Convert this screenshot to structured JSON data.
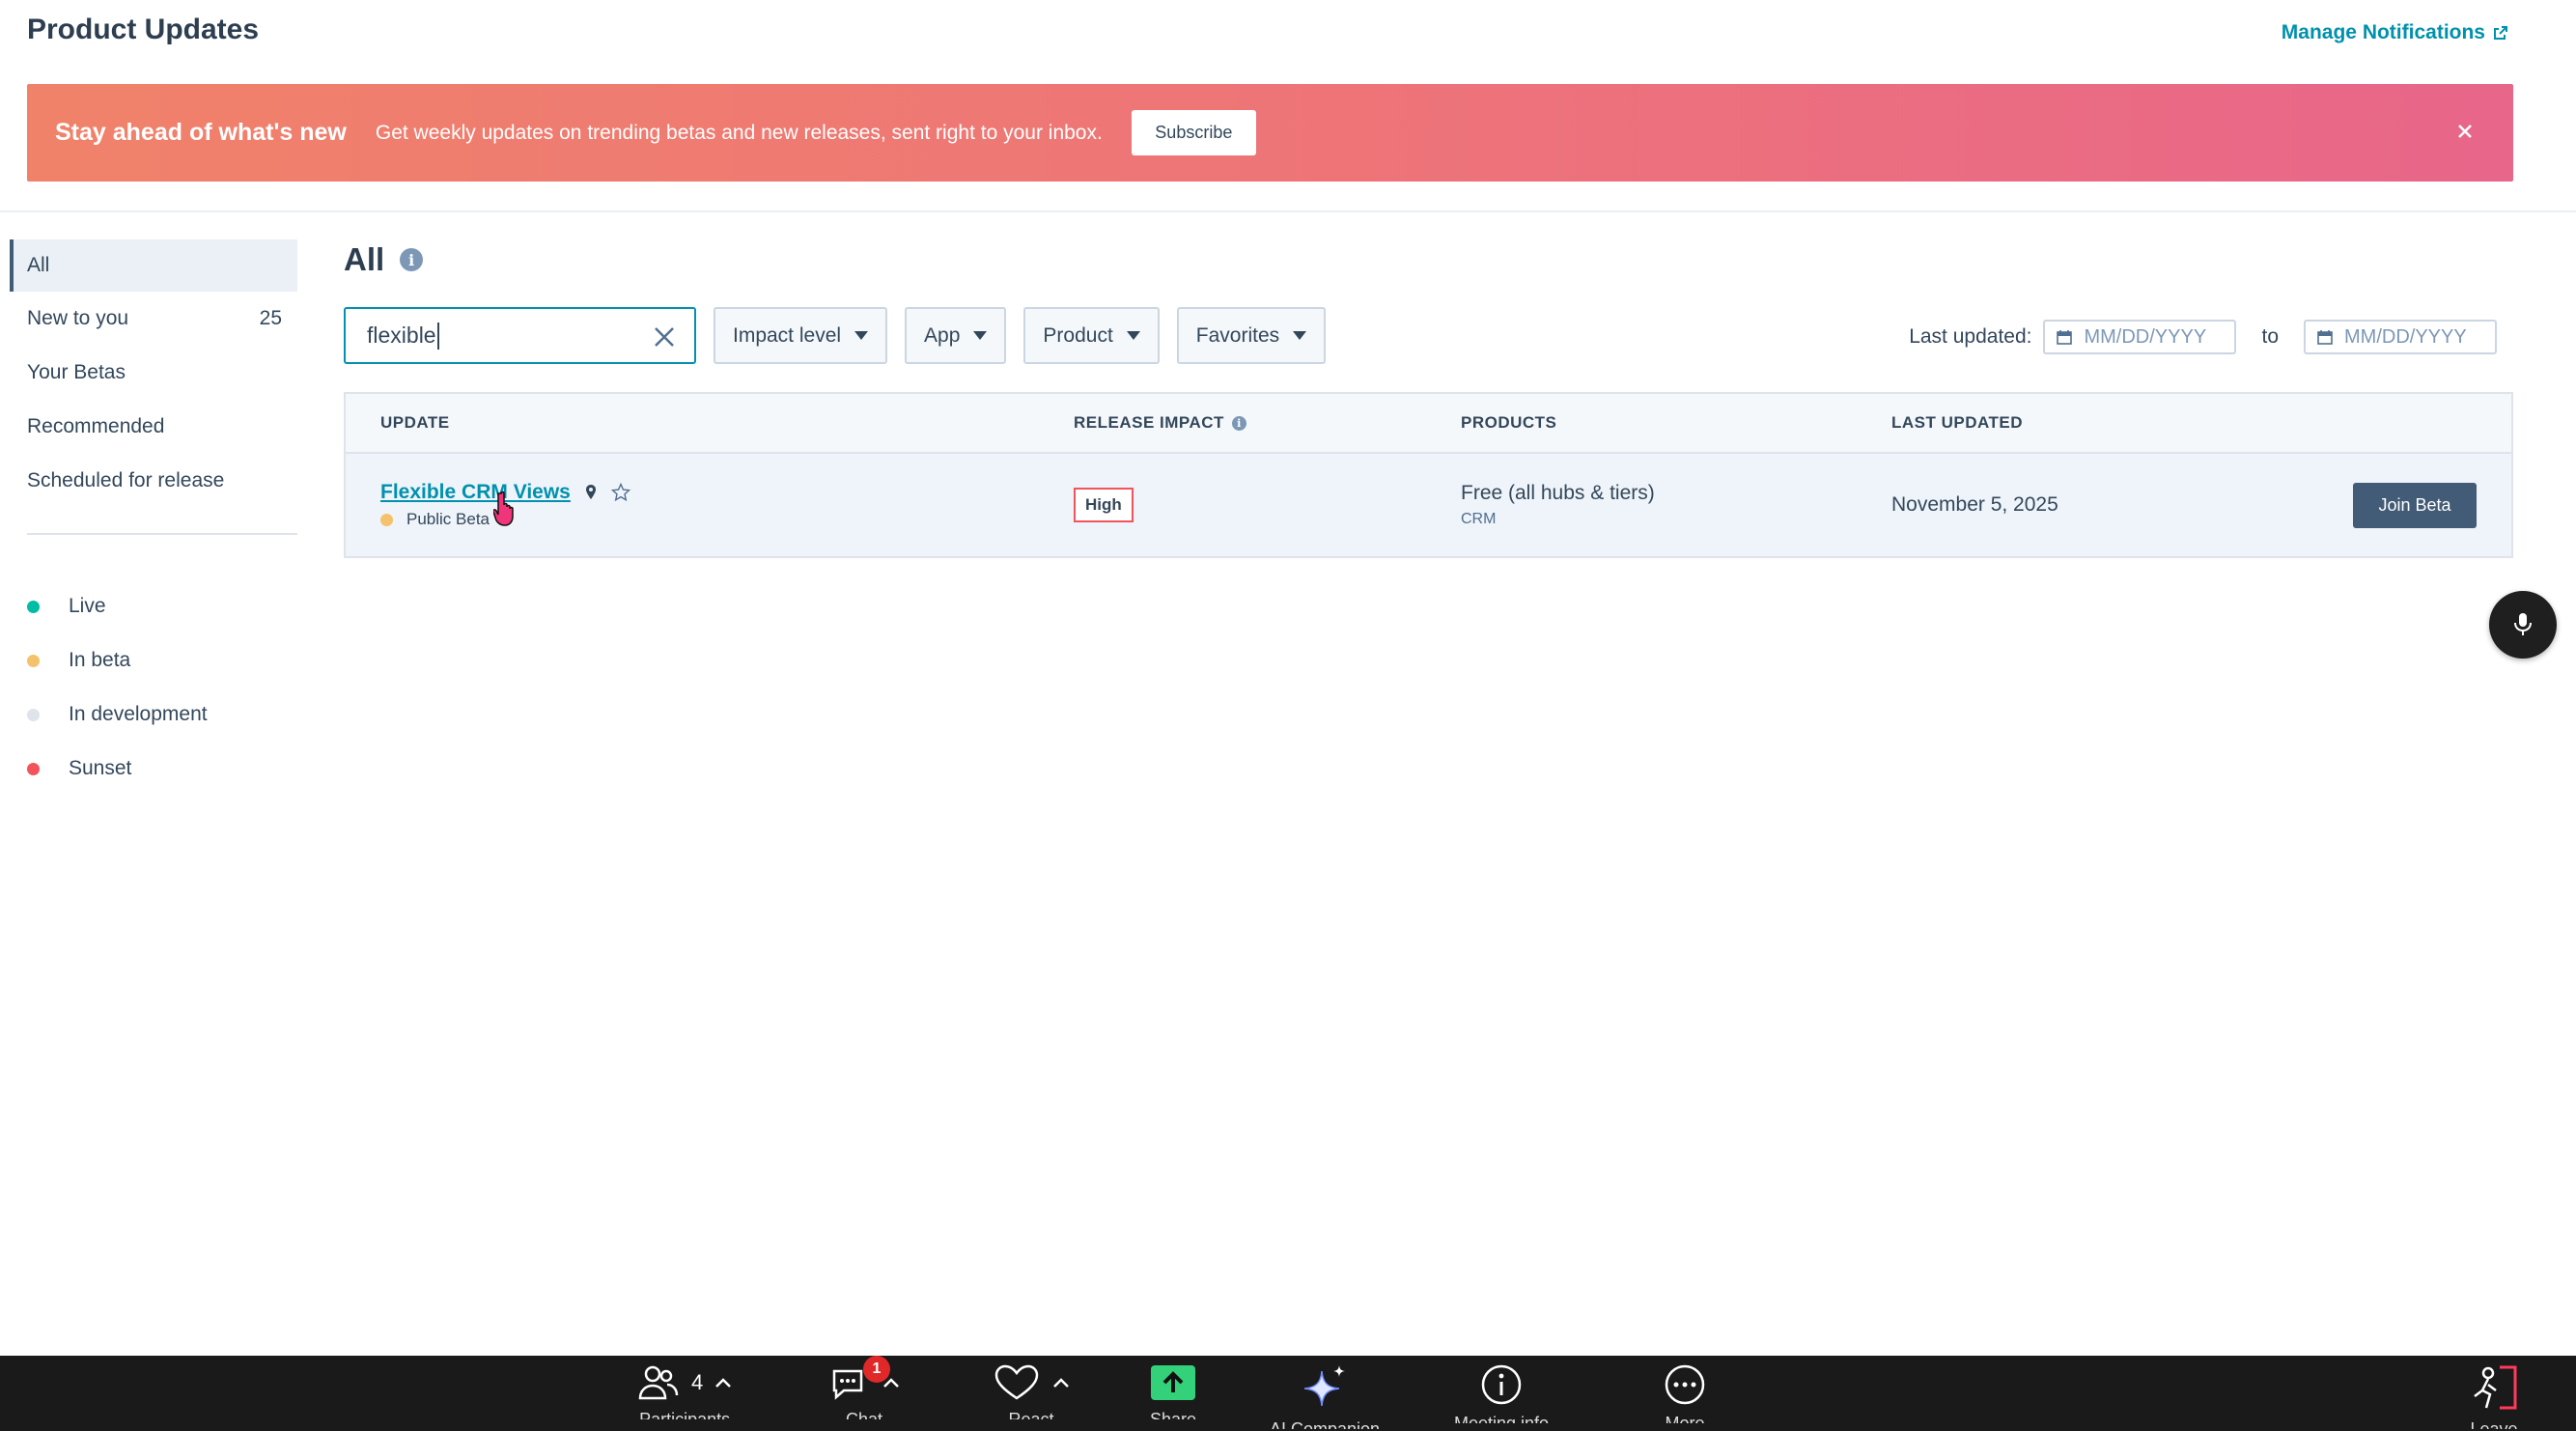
{
  "page": {
    "title": "Product Updates",
    "manage_link": "Manage Notifications"
  },
  "banner": {
    "title": "Stay ahead of what's new",
    "text": "Get weekly updates on trending betas and new releases, sent right to your inbox.",
    "button": "Subscribe",
    "gradient": [
      "#f0826a",
      "#e8668a"
    ]
  },
  "sidebar": {
    "items": [
      {
        "label": "All",
        "count": ""
      },
      {
        "label": "New to you",
        "count": "25"
      },
      {
        "label": "Your Betas",
        "count": ""
      },
      {
        "label": "Recommended",
        "count": ""
      },
      {
        "label": "Scheduled for release",
        "count": ""
      }
    ],
    "legend": [
      {
        "label": "Live",
        "color": "#00bda5"
      },
      {
        "label": "In beta",
        "color": "#f5c26b"
      },
      {
        "label": "In development",
        "color": "#dfe3eb"
      },
      {
        "label": "Sunset",
        "color": "#f2545b"
      }
    ]
  },
  "main": {
    "title": "All",
    "search": {
      "value": "flexible"
    },
    "filters": [
      "Impact level",
      "App",
      "Product",
      "Favorites"
    ],
    "date": {
      "label": "Last updated:",
      "from_placeholder": "MM/DD/YYYY",
      "to_label": "to",
      "to_placeholder": "MM/DD/YYYY"
    }
  },
  "table": {
    "headers": {
      "update": "UPDATE",
      "impact": "RELEASE IMPACT",
      "products": "PRODUCTS",
      "last_updated": "LAST UPDATED"
    },
    "rows": [
      {
        "title": "Flexible CRM Views",
        "status": "Public Beta",
        "status_color": "#f5c26b",
        "impact": "High",
        "product": "Free (all hubs & tiers)",
        "product_sub": "CRM",
        "last_updated": "November 5, 2025",
        "action": "Join Beta"
      }
    ]
  },
  "meeting_bar": {
    "participants_count": "4",
    "chat_badge": "1",
    "labels": [
      "Participants",
      "Chat",
      "React",
      "Share",
      "AI Companion",
      "Meeting info",
      "More",
      "Leave"
    ]
  }
}
